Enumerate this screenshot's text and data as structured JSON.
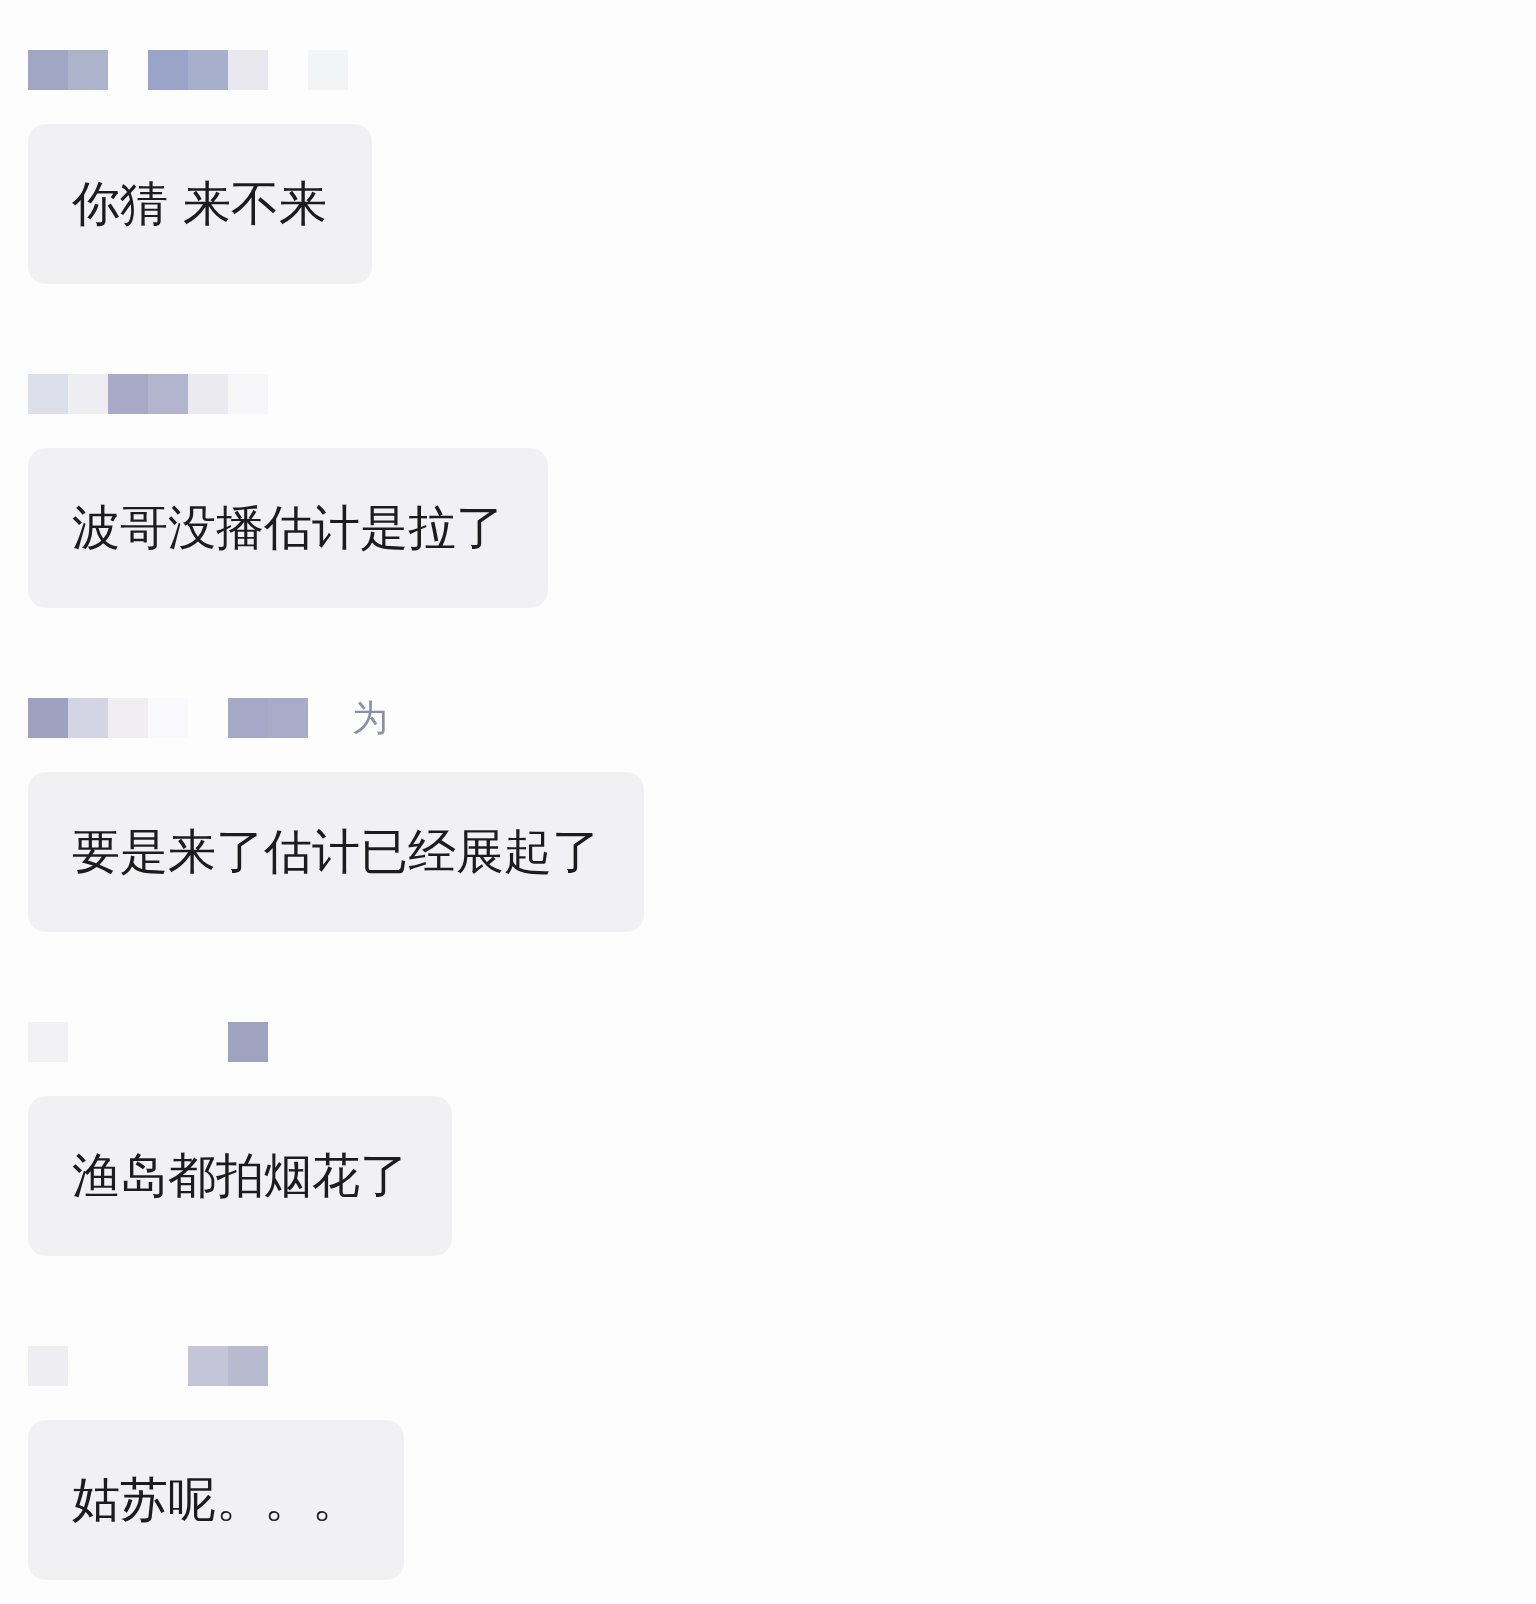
{
  "messages": [
    {
      "text": "你猜 来不来"
    },
    {
      "text": "波哥没播估计是拉了"
    },
    {
      "sender_visible": "为",
      "text": "要是来了估计已经展起了"
    },
    {
      "text": "渔岛都拍烟花了"
    },
    {
      "text": "姑苏呢。。。"
    }
  ]
}
